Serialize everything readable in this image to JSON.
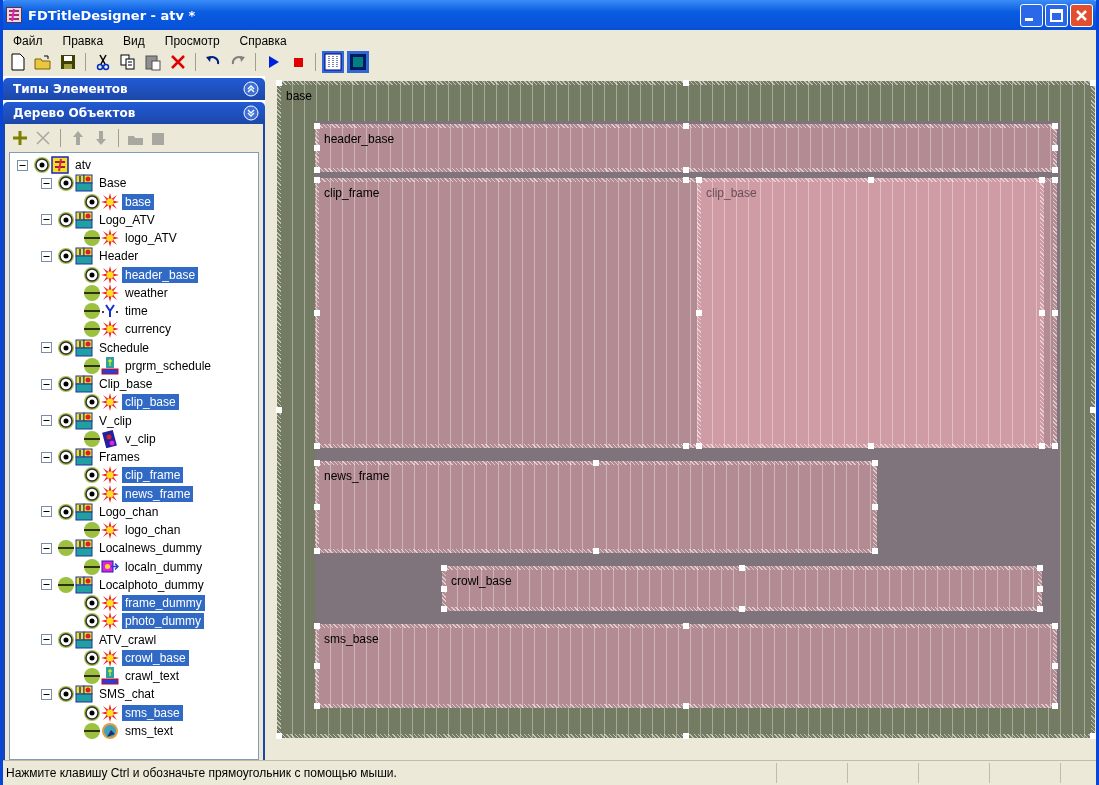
{
  "window": {
    "title": "FDTitleDesigner - atv *"
  },
  "menu": [
    "Файл",
    "Правка",
    "Вид",
    "Просмотр",
    "Справка"
  ],
  "toolbar": [
    [
      {
        "kind": "new",
        "selected": false
      },
      {
        "kind": "open",
        "selected": false
      },
      {
        "kind": "save",
        "selected": false
      }
    ],
    [
      {
        "kind": "cut",
        "selected": false
      },
      {
        "kind": "copy",
        "selected": false
      },
      {
        "kind": "paste",
        "selected": false
      },
      {
        "kind": "delete",
        "selected": false
      }
    ],
    [
      {
        "kind": "undo",
        "selected": false
      },
      {
        "kind": "redo",
        "selected": false
      }
    ],
    [
      {
        "kind": "play",
        "selected": false
      },
      {
        "kind": "stop",
        "selected": false
      }
    ],
    [
      {
        "kind": "grid",
        "selected": true
      },
      {
        "kind": "fill",
        "selected": true
      }
    ]
  ],
  "panels": [
    {
      "title": "Типы Элементов",
      "expanded": false
    },
    {
      "title": "Дерево Объектов",
      "expanded": true
    }
  ],
  "tree_toolbar": [
    [
      {
        "kind": "add",
        "disabled": false
      },
      {
        "kind": "remove",
        "disabled": true
      }
    ],
    [
      {
        "kind": "up",
        "disabled": true
      },
      {
        "kind": "down",
        "disabled": true
      }
    ],
    [
      {
        "kind": "load",
        "disabled": true
      },
      {
        "kind": "store",
        "disabled": true
      }
    ]
  ],
  "tree": {
    "label": "atv",
    "visible": true,
    "selected": false,
    "expanded": true,
    "children": [
      {
        "label": "Base",
        "visible": true,
        "selected": false,
        "expanded": true,
        "children": [
          {
            "label": "base",
            "kind": "effect",
            "visible": true,
            "selected": true
          }
        ]
      },
      {
        "label": "Logo_ATV",
        "visible": true,
        "selected": false,
        "expanded": true,
        "children": [
          {
            "label": "logo_ATV",
            "kind": "effect",
            "visible": false,
            "selected": false
          }
        ]
      },
      {
        "label": "Header",
        "visible": true,
        "selected": false,
        "expanded": true,
        "children": [
          {
            "label": "header_base",
            "kind": "effect",
            "visible": true,
            "selected": true
          },
          {
            "label": "weather",
            "kind": "effect",
            "visible": false,
            "selected": false
          },
          {
            "label": "time",
            "kind": "clock",
            "visible": false,
            "selected": false
          },
          {
            "label": "currency",
            "kind": "effect",
            "visible": false,
            "selected": false
          }
        ]
      },
      {
        "label": "Schedule",
        "visible": true,
        "selected": false,
        "expanded": true,
        "children": [
          {
            "label": "prgrm_schedule",
            "kind": "text",
            "visible": false,
            "selected": false
          }
        ]
      },
      {
        "label": "Clip_base",
        "visible": true,
        "selected": false,
        "expanded": true,
        "children": [
          {
            "label": "clip_base",
            "kind": "effect",
            "visible": true,
            "selected": true
          }
        ]
      },
      {
        "label": "V_clip",
        "visible": true,
        "selected": false,
        "expanded": true,
        "children": [
          {
            "label": "v_clip",
            "kind": "clip",
            "visible": false,
            "selected": false
          }
        ]
      },
      {
        "label": "Frames",
        "visible": true,
        "selected": false,
        "expanded": true,
        "children": [
          {
            "label": "clip_frame",
            "kind": "effect",
            "visible": true,
            "selected": true
          },
          {
            "label": "news_frame",
            "kind": "effect",
            "visible": true,
            "selected": true
          }
        ]
      },
      {
        "label": "Logo_chan",
        "visible": true,
        "selected": false,
        "expanded": true,
        "children": [
          {
            "label": "logo_chan",
            "kind": "effect",
            "visible": false,
            "selected": false
          }
        ]
      },
      {
        "label": "Localnews_dummy",
        "visible": false,
        "selected": false,
        "expanded": true,
        "children": [
          {
            "label": "localn_dummy",
            "kind": "dummy",
            "visible": false,
            "selected": false
          }
        ]
      },
      {
        "label": "Localphoto_dummy",
        "visible": false,
        "selected": false,
        "expanded": true,
        "children": [
          {
            "label": "frame_dummy",
            "kind": "effect",
            "visible": true,
            "selected": true
          },
          {
            "label": "photo_dummy",
            "kind": "effect",
            "visible": true,
            "selected": true
          }
        ]
      },
      {
        "label": "ATV_crawl",
        "visible": true,
        "selected": false,
        "expanded": true,
        "children": [
          {
            "label": "crowl_base",
            "kind": "effect",
            "visible": true,
            "selected": true
          },
          {
            "label": "crawl_text",
            "kind": "text",
            "visible": false,
            "selected": false
          }
        ]
      },
      {
        "label": "SMS_chat",
        "visible": true,
        "selected": false,
        "expanded": true,
        "children": [
          {
            "label": "sms_base",
            "kind": "effect",
            "visible": true,
            "selected": true
          },
          {
            "label": "sms_text",
            "kind": "globe",
            "visible": false,
            "selected": false
          }
        ]
      }
    ]
  },
  "canvas": {
    "elements": [
      {
        "label": "base",
        "kind": "base"
      },
      {
        "label": "header_base",
        "kind": "region"
      },
      {
        "label": "clip_frame",
        "kind": "region"
      },
      {
        "label": "clip_base",
        "kind": "active"
      },
      {
        "label": "news_frame",
        "kind": "region"
      },
      {
        "label": "crowl_base",
        "kind": "region"
      },
      {
        "label": "sms_base",
        "kind": "region"
      }
    ]
  },
  "status_bar": {
    "text": "Нажмите клавишу Ctrl и обозначьте прямоугольник с помощью мыши."
  }
}
